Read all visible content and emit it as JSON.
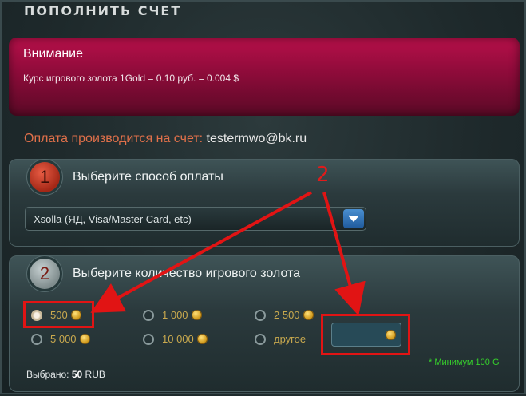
{
  "page": {
    "title": "ПОПОЛНИТЬ СЧЕТ"
  },
  "alert": {
    "title": "Внимание",
    "text": "Курс игрового золота 1Gold = 0.10 руб. = 0.004 $"
  },
  "payment_notice": {
    "label": "Оплата производится на счет:",
    "email": "testermwo@bk.ru"
  },
  "step1": {
    "number": "1",
    "title": "Выберите способ оплаты",
    "selected_method": "Xsolla (ЯД, Visa/Master Card, etc)"
  },
  "step2": {
    "number": "2",
    "title": "Выберите количество игрового золота",
    "options": [
      {
        "label": "500",
        "checked": true
      },
      {
        "label": "1 000",
        "checked": false
      },
      {
        "label": "2 500",
        "checked": false
      },
      {
        "label": "5 000",
        "checked": false
      },
      {
        "label": "10 000",
        "checked": false
      },
      {
        "label": "другое",
        "checked": false
      }
    ],
    "custom_amount": "",
    "min_note": "* Минимум 100 G",
    "selected_label": "Выбрано:",
    "selected_value": "50",
    "selected_currency": "RUB"
  },
  "annotation": {
    "number": "2",
    "color": "#e11414"
  },
  "colors": {
    "alert": "#a80e44",
    "accent_orange": "#e0704a",
    "gold_text": "#c9a94e",
    "min_note": "#36d02c"
  }
}
